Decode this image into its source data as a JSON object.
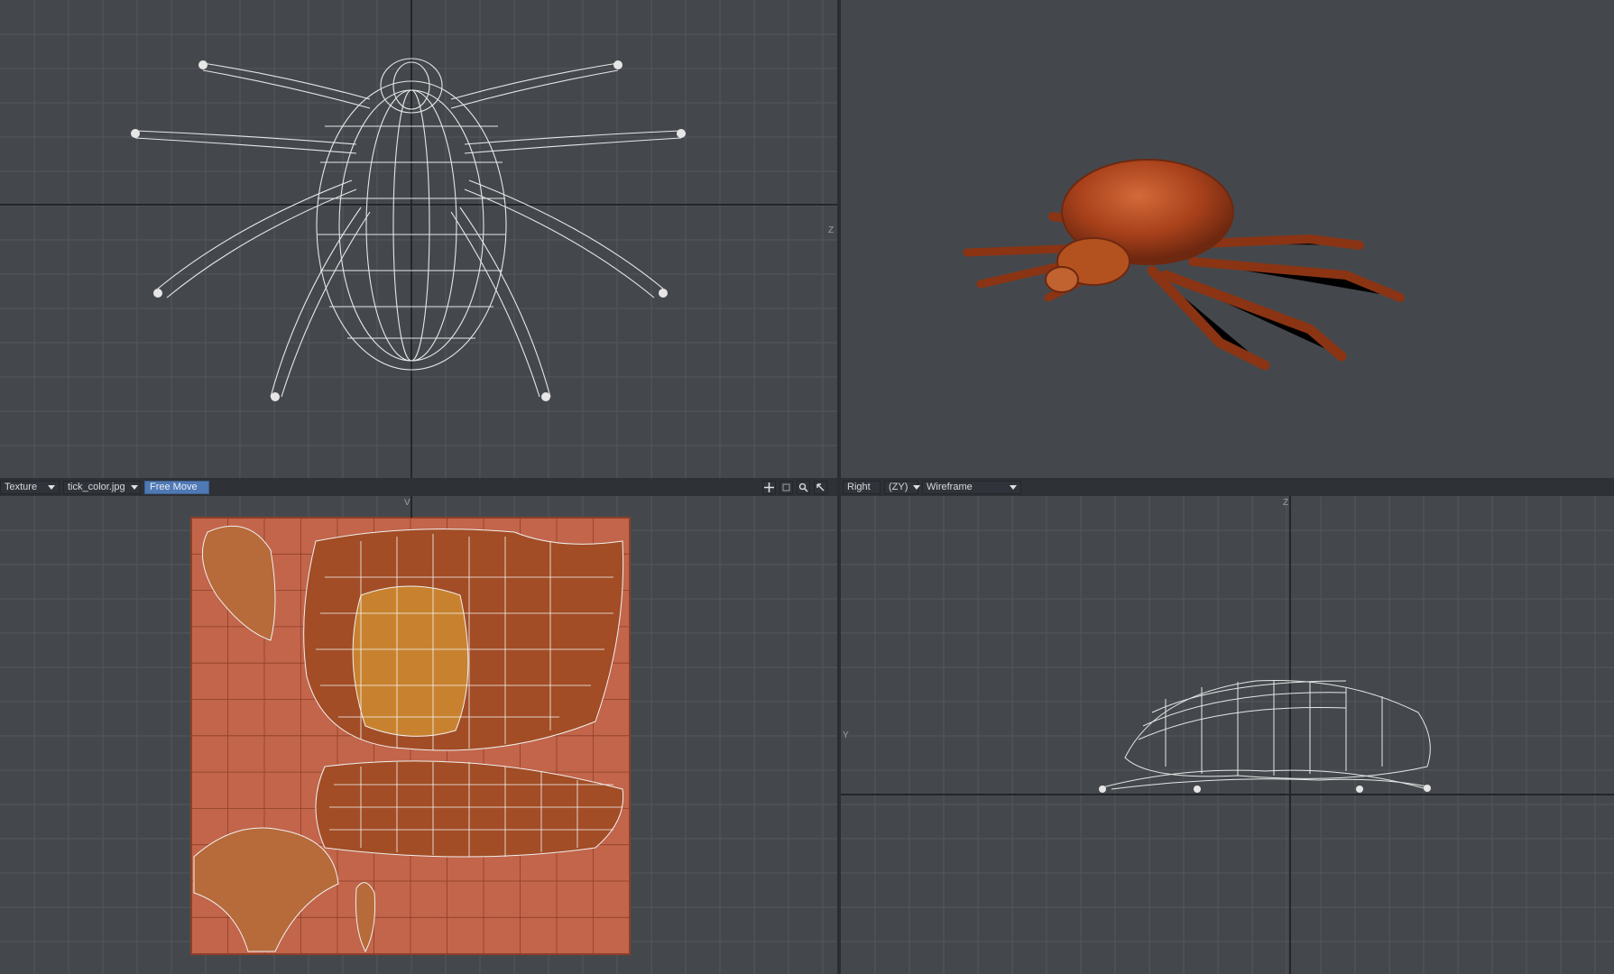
{
  "bottom_left_header": {
    "view_mode": "Texture",
    "image_map": "tick_color.jpg",
    "tool": "Free Move"
  },
  "bottom_right_header": {
    "view": "Right",
    "axes": "(ZY)",
    "render_mode": "Wireframe"
  },
  "axis_labels": {
    "top_left_z": "Z",
    "bottom_left_v": "V",
    "bottom_right_z": "Z",
    "bottom_right_y": "Y"
  },
  "icons": [
    "move-view-icon",
    "rotate-view-icon",
    "zoom-icon",
    "maximize-icon"
  ],
  "colors": {
    "viewport_bg": "#44484d",
    "grid_line": "#53575c",
    "axis_line": "#23262a",
    "wire": "#e6e6e6",
    "tick_body": "#a8411b",
    "texture_bg": "#c2654a",
    "tool_active": "#4f79b5"
  }
}
